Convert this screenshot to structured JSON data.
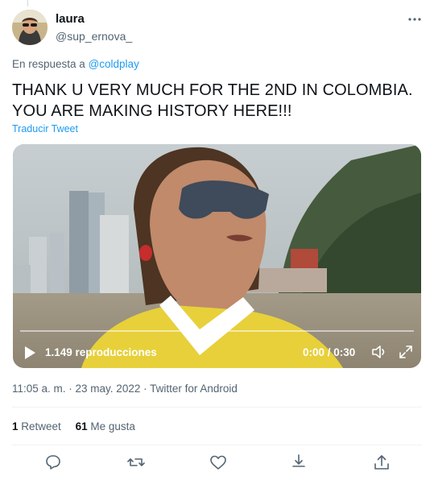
{
  "author": {
    "name": "laura",
    "handle": "@sup_ernova_"
  },
  "reply": {
    "prefix": "En respuesta a",
    "mention": "@coldplay"
  },
  "tweet": {
    "line1": "THANK U VERY MUCH FOR THE 2ND IN COLOMBIA.",
    "line2": "YOU ARE MAKING HISTORY HERE!!!",
    "translate": "Traducir Tweet"
  },
  "video": {
    "views": "1.149 reproducciones",
    "time": "0:00 / 0:30"
  },
  "meta": "11:05 a. m. · 23 may. 2022 · Twitter for Android",
  "stats": {
    "retweets_count": "1",
    "retweets_label": "Retweet",
    "likes_count": "61",
    "likes_label": "Me gusta"
  },
  "icons": {
    "more": "more-icon",
    "play": "play-icon",
    "volume": "volume-icon",
    "expand": "expand-icon",
    "reply": "reply-icon",
    "retweet": "retweet-icon",
    "like": "like-icon",
    "bookmark": "bookmark-icon",
    "share": "share-icon"
  },
  "colors": {
    "accent": "#1d9bf0",
    "secondary_text": "#536471",
    "primary_text": "#0f1419"
  }
}
